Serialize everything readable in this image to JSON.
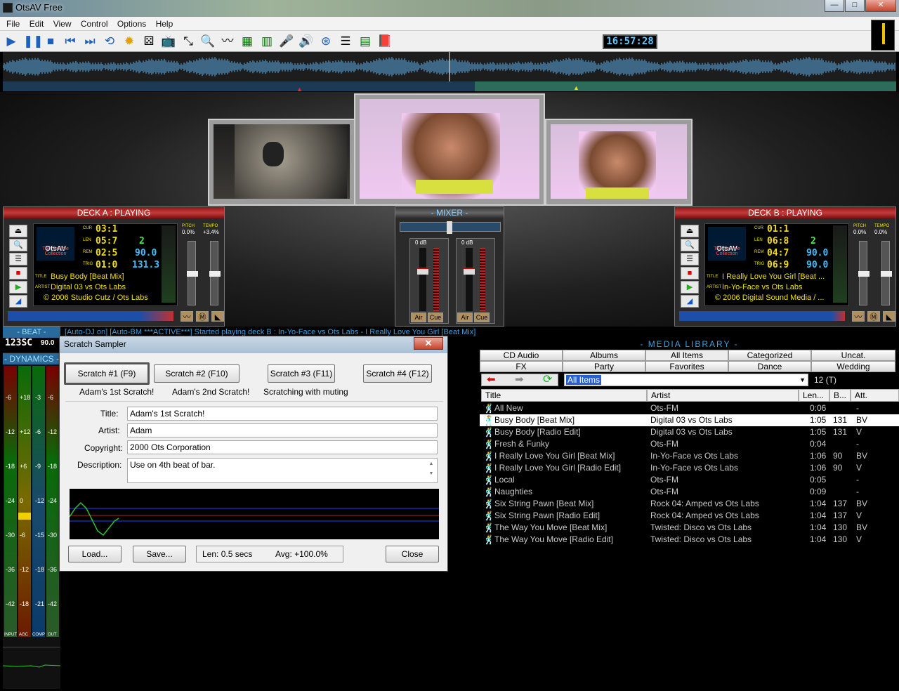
{
  "window": {
    "title": "OtsAV Free",
    "min": "—",
    "max": "□",
    "close": "✕"
  },
  "menu": [
    "File",
    "Edit",
    "View",
    "Control",
    "Options",
    "Help"
  ],
  "toolbar": {
    "icons": [
      "play-icon",
      "pause-icon",
      "stop-icon",
      "prev-icon",
      "next-icon",
      "loop-icon",
      "effects-icon",
      "random-icon",
      "video-icon",
      "crop-icon",
      "search-icon",
      "wave-icon",
      "eq-icon",
      "meter-icon",
      "mic-icon",
      "volume-icon",
      "cd-icon",
      "playlist-icon",
      "media-library-icon",
      "book-icon"
    ],
    "clock": "16:57:28"
  },
  "deck_a": {
    "header": "DECK A : PLAYING",
    "labels": {
      "cur": "CUR",
      "len": "LEN",
      "rem": "REM",
      "trig": "TRIG",
      "pitch": "PITCH",
      "tempo": "TEMPO",
      "title": "TITLE",
      "artist": "ARTIST"
    },
    "cur": "03:1",
    "len": "05:7",
    "rem": "02:5",
    "trig": "01:0",
    "num_a": "2",
    "num_b": "90.0",
    "num_c": "131.3",
    "pitch": "0.0%",
    "tempo": "+3.4%",
    "title": "Busy Body [Beat Mix]",
    "artist": "Digital 03 vs Ots Labs",
    "copyright": "© 2006 Studio Cutz / Ots Labs",
    "brand": "OtsAV",
    "collection": "The Sample Collection"
  },
  "deck_b": {
    "header": "DECK B : PLAYING",
    "cur": "01:1",
    "len": "06:8",
    "rem": "04:7",
    "trig": "06:9",
    "num_a": "2",
    "num_b": "90.0",
    "num_c": "90.0",
    "pitch": "0.0%",
    "tempo": "0.0%",
    "title": "I Really Love You Girl [Beat ...",
    "artist": "In-Yo-Face vs Ots Labs",
    "copyright": "© 2006 Digital Sound Media / ...",
    "brand": "OtsAV",
    "collection": "The Sample Collection"
  },
  "mixer": {
    "header": "- MIXER -",
    "db_left": "0 dB",
    "db_right": "0 dB",
    "air": "Air",
    "cue": "Cue"
  },
  "status": {
    "text": "[Auto-DJ on]  [Auto-BM ***ACTIVE***]  Started playing deck B : In-Yo-Face vs Ots Labs - I Really Love You Girl [Beat Mix]"
  },
  "left": {
    "beat": "- BEAT -",
    "dynamics": "- DYNAMICS -",
    "beat_digits": "123SC",
    "beat_num": "90.0",
    "scale_labels": [
      "-6",
      "+18",
      "-3",
      "-6",
      "-12",
      "+12",
      "-6",
      "-12",
      "-18",
      "+6",
      "-9",
      "-18",
      "-24",
      "0",
      "-12",
      "-24",
      "-30",
      "-6",
      "-15",
      "-30",
      "-36",
      "-12",
      "-18",
      "-36",
      "-42",
      "-18",
      "-21",
      "-42"
    ],
    "footer": [
      "INPUT",
      "AGC",
      "COMP",
      "OUT"
    ]
  },
  "dialog": {
    "title": "Scratch Sampler",
    "close": "✕",
    "scratch_buttons": [
      "Scratch #1 (F9)",
      "Scratch #2 (F10)",
      "Scratch #3 (F11)",
      "Scratch #4 (F12)"
    ],
    "scratch_names": [
      "Adam's 1st Scratch!",
      "Adam's 2nd Scratch!",
      "Scratching with muting",
      ""
    ],
    "fields": {
      "title_label": "Title:",
      "title": "Adam's 1st Scratch!",
      "artist_label": "Artist:",
      "artist": "Adam",
      "copyright_label": "Copyright:",
      "copyright": "2000 Ots Corporation",
      "description_label": "Description:",
      "description": "Use on 4th beat of bar."
    },
    "load": "Load...",
    "save": "Save...",
    "len": "Len:  0.5 secs",
    "avg": "Avg:  +100.0%",
    "close_btn": "Close"
  },
  "library": {
    "header": "- MEDIA LIBRARY -",
    "tabs": [
      [
        "CD Audio",
        "Albums",
        "All Items",
        "Categorized",
        "Uncat."
      ],
      [
        "FX",
        "Party",
        "Favorites",
        "Dance",
        "Wedding"
      ]
    ],
    "selected_tab": "All Items",
    "filter": "All Items",
    "count": "12 (T)",
    "columns": [
      "Title",
      "Artist",
      "Len...",
      "B...",
      "Att."
    ],
    "rows": [
      {
        "title": "All New",
        "artist": "Ots-FM",
        "len": "0:06",
        "bpm": "",
        "att": "-"
      },
      {
        "title": "Busy Body [Beat Mix]",
        "artist": "Digital 03 vs Ots Labs",
        "len": "1:05",
        "bpm": "131",
        "att": "BV"
      },
      {
        "title": "Busy Body [Radio Edit]",
        "artist": "Digital 03 vs Ots Labs",
        "len": "1:05",
        "bpm": "131",
        "att": "V"
      },
      {
        "title": "Fresh & Funky",
        "artist": "Ots-FM",
        "len": "0:04",
        "bpm": "",
        "att": "-"
      },
      {
        "title": "I Really Love You Girl [Beat Mix]",
        "artist": "In-Yo-Face vs Ots Labs",
        "len": "1:06",
        "bpm": "90",
        "att": "BV"
      },
      {
        "title": "I Really Love You Girl [Radio Edit]",
        "artist": "In-Yo-Face vs Ots Labs",
        "len": "1:06",
        "bpm": "90",
        "att": "V"
      },
      {
        "title": "Local",
        "artist": "Ots-FM",
        "len": "0:05",
        "bpm": "",
        "att": "-"
      },
      {
        "title": "Naughties",
        "artist": "Ots-FM",
        "len": "0:09",
        "bpm": "",
        "att": "-"
      },
      {
        "title": "Six String Pawn [Beat Mix]",
        "artist": "Rock 04: Amped vs Ots Labs",
        "len": "1:04",
        "bpm": "137",
        "att": "BV"
      },
      {
        "title": "Six String Pawn [Radio Edit]",
        "artist": "Rock 04: Amped vs Ots Labs",
        "len": "1:04",
        "bpm": "137",
        "att": "V"
      },
      {
        "title": "The Way You Move [Beat Mix]",
        "artist": "Twisted: Disco vs Ots Labs",
        "len": "1:04",
        "bpm": "130",
        "att": "BV"
      },
      {
        "title": "The Way You Move [Radio Edit]",
        "artist": "Twisted: Disco vs Ots Labs",
        "len": "1:04",
        "bpm": "130",
        "att": "V"
      }
    ],
    "selected_row": 1
  },
  "colors": {
    "accent": "#1e5fbf",
    "deck_header": "#b02a2a",
    "led_yellow": "#f2e000",
    "led_cyan": "#3fbfff",
    "mixer_text": "#8fd0ff",
    "row_text": "#c9c9c9"
  }
}
